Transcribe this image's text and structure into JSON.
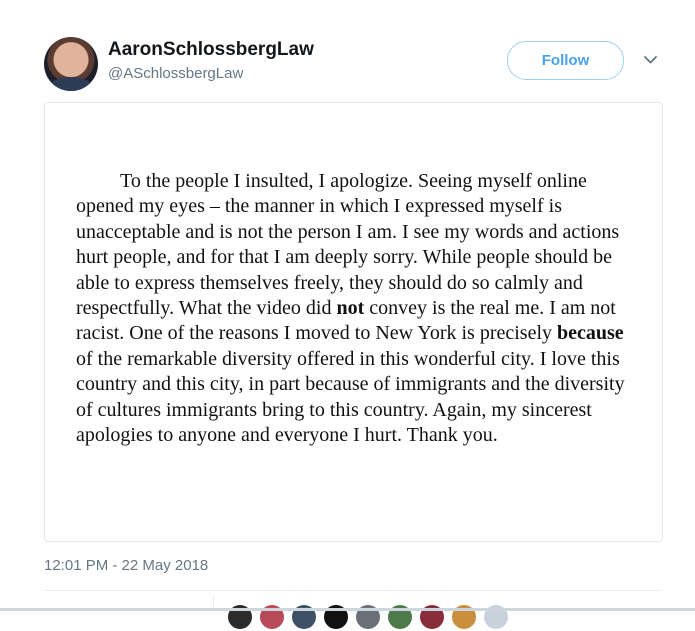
{
  "tweet": {
    "display_name": "AaronSchlossbergLaw",
    "handle": "@ASchlossbergLaw",
    "follow_label": "Follow",
    "timestamp": "12:01 PM - 22 May 2018"
  },
  "statement": {
    "part1": "To the people I insulted, I apologize.  Seeing myself online opened my eyes – the manner in which I expressed myself is unacceptable and is not the person I am.  I see my words and actions hurt people, and for that I am deeply sorry.  While people should be able to express themselves freely, they should do so calmly and respectfully.  What the video did ",
    "bold1": "not",
    "part2": " convey is the real me.  I am not racist.  One of the reasons I moved to New York is precisely ",
    "bold2": "because",
    "part3": " of the remarkable diversity offered in this wonderful city.  I love this country and this city, in part because of immigrants and the diversity of cultures immigrants bring to this country.  Again, my sincerest apologies to anyone and everyone I hurt.  Thank you."
  },
  "colors": {
    "accent": "#1da1f2",
    "text": "#14171a",
    "secondary_text": "#657786"
  },
  "icons": {
    "menu": "chevron-down-icon"
  }
}
